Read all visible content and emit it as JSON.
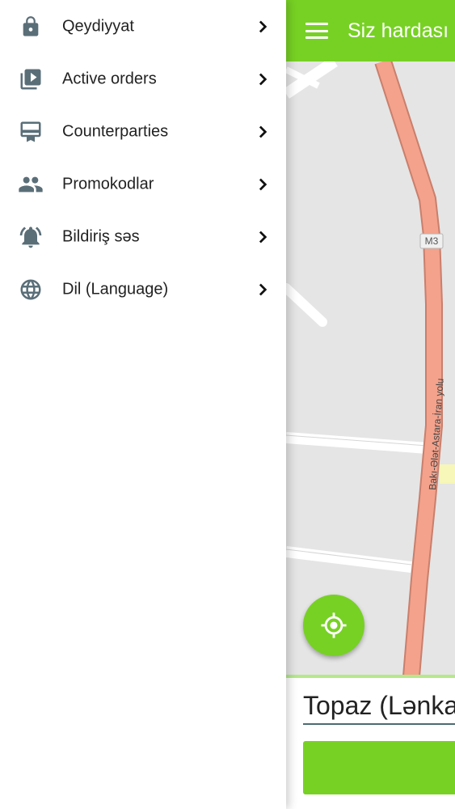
{
  "drawer": {
    "items": [
      {
        "label": "Qeydiyyat",
        "icon": "lock-icon"
      },
      {
        "label": "Active orders",
        "icon": "video-library-icon"
      },
      {
        "label": "Counterparties",
        "icon": "card-icon"
      },
      {
        "label": "Promokodlar",
        "icon": "people-icon"
      },
      {
        "label": "Bildiriş səs",
        "icon": "alarm-bell-icon"
      },
      {
        "label": "Dil (Language)",
        "icon": "globe-icon"
      }
    ]
  },
  "appbar": {
    "title": "Siz hardası"
  },
  "map": {
    "road_badge": "M3",
    "road_name": "Bakı-Ələt-Astara-İran yolu"
  },
  "bottom": {
    "address": "Topaz (Lənka"
  },
  "colors": {
    "accent": "#77d124",
    "icon": "#5a6e78",
    "road": "#f4a28c"
  }
}
